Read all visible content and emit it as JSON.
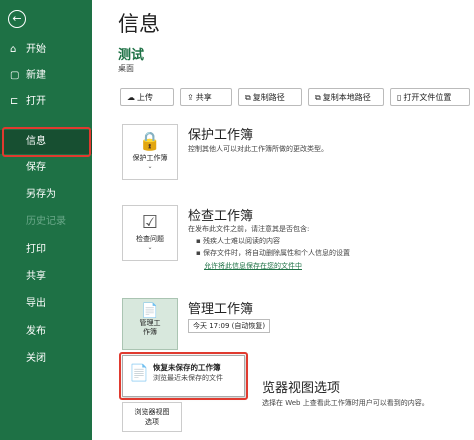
{
  "sidebar": {
    "back_glyph": "←",
    "items": [
      {
        "label": "开始",
        "icon": "home-icon",
        "glyph": "⌂"
      },
      {
        "label": "新建",
        "icon": "new-document-icon",
        "glyph": "▢"
      },
      {
        "label": "打开",
        "icon": "folder-icon",
        "glyph": "⊏"
      },
      {
        "label": "信息",
        "active": true
      },
      {
        "label": "保存"
      },
      {
        "label": "另存为"
      },
      {
        "label": "历史记录",
        "disabled": true
      },
      {
        "label": "打印"
      },
      {
        "label": "共享"
      },
      {
        "label": "导出"
      },
      {
        "label": "发布"
      },
      {
        "label": "关闭"
      }
    ]
  },
  "header": {
    "title": "信息",
    "doc_name": "测试",
    "doc_location": "桌面"
  },
  "toolbar": {
    "buttons": [
      {
        "label": "上传",
        "glyph": "☁"
      },
      {
        "label": "共享",
        "glyph": "⇪"
      },
      {
        "label": "复制路径",
        "glyph": "⧉"
      },
      {
        "label": "复制本地路径",
        "glyph": "⧉"
      },
      {
        "label": "打开文件位置",
        "glyph": "▯"
      }
    ]
  },
  "protect": {
    "card_label": "保护工作簿",
    "title": "保护工作簿",
    "desc": "控制其他人可以对此工作簿所做的更改类型。"
  },
  "inspect": {
    "card_label": "检查问题",
    "title": "检查工作簿",
    "desc": "在发布此文件之前，请注意其是否包含:",
    "bullets": [
      "残疾人士难以阅读的内容",
      "保存文件时，将自动删除属性和个人信息的设置"
    ],
    "link": "允许将此信息保存在您的文件中"
  },
  "manage": {
    "card_label_1": "管理工",
    "card_label_2": "作簿",
    "title": "管理工作簿",
    "autosave": "今天 17:09 (自动恢复)"
  },
  "dropdown": {
    "title": "恢复未保存的工作簿",
    "desc": "浏览最近未保存的文件"
  },
  "browser": {
    "title": "浏览器视图选项",
    "title_visible": "览器视图选项",
    "desc": "选择在 Web 上查看此工作簿时用户可以看到的内容。",
    "card_label_1": "浏览器视图",
    "card_label_2": "选项"
  },
  "colors": {
    "sidebar_bg": "#1e7145",
    "active_bg": "#174f31",
    "highlight": "#e03a2f",
    "accent": "#1e7145"
  }
}
